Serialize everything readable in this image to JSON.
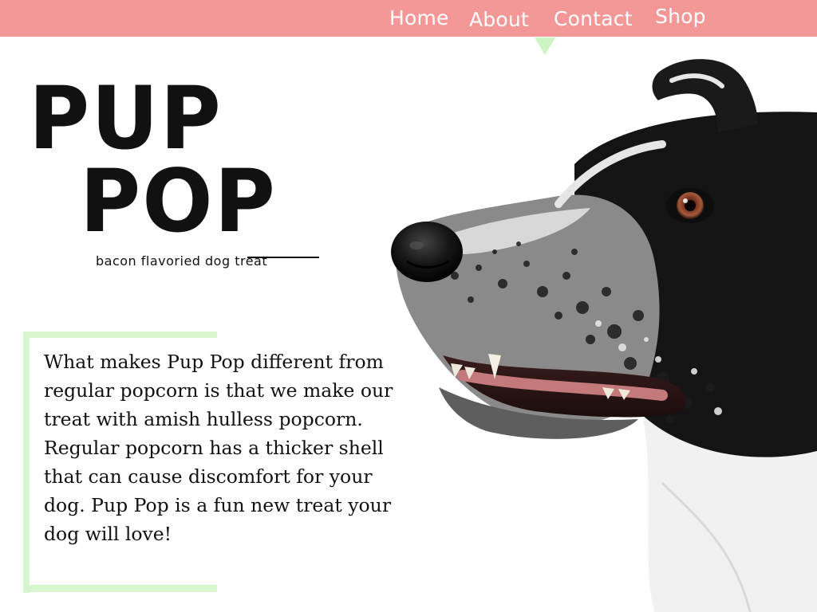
{
  "nav": {
    "items": [
      {
        "label": "Home"
      },
      {
        "label": "About"
      },
      {
        "label": "Contact"
      },
      {
        "label": "Shop"
      }
    ],
    "active": "Contact"
  },
  "brand": {
    "line1": "PUP",
    "line2": "POP",
    "tagline": "bacon flavoried dog treat"
  },
  "description": {
    "text": "What makes Pup Pop different from regular popcorn is that we make our treat with amish hulless popcorn. Regular popcorn has a thicker shell that can cause discomfort for your dog. Pup Pop is a fun new treat your dog will love!"
  },
  "colors": {
    "header": "#f39797",
    "accent_green": "#d6f7cd",
    "text": "#111111"
  },
  "icons": {
    "nav_indicator": "triangle-down-icon",
    "hero_image": "dog-photo"
  }
}
